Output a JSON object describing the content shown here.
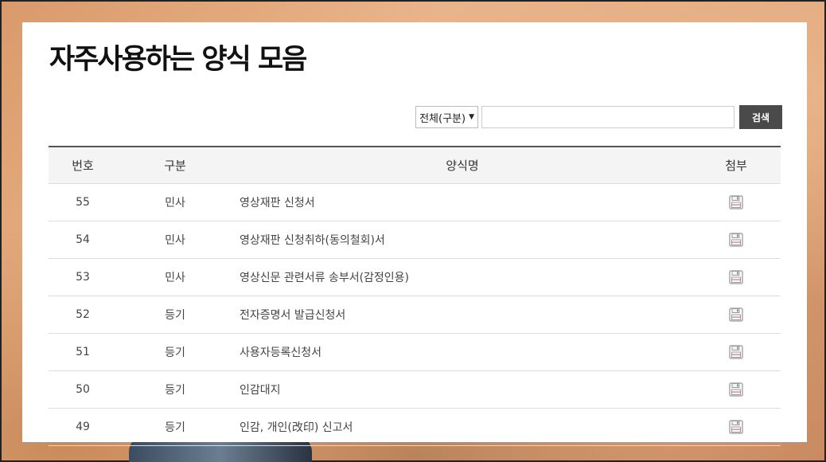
{
  "page": {
    "title": "자주사용하는 양식 모음"
  },
  "search": {
    "category_selected": "전체(구분)",
    "query_value": "",
    "query_placeholder": "",
    "button_label": "검색"
  },
  "table": {
    "headers": {
      "no": "번호",
      "category": "구분",
      "name": "양식명",
      "attachment": "첨부"
    },
    "rows": [
      {
        "no": "55",
        "category": "민사",
        "name": "영상재판 신청서",
        "icon": "save-icon"
      },
      {
        "no": "54",
        "category": "민사",
        "name": "영상재판 신청취하(동의철회)서",
        "icon": "save-icon"
      },
      {
        "no": "53",
        "category": "민사",
        "name": "영상신문 관련서류 송부서(감정인용)",
        "icon": "save-icon"
      },
      {
        "no": "52",
        "category": "등기",
        "name": "전자증명서 발급신청서",
        "icon": "save-icon"
      },
      {
        "no": "51",
        "category": "등기",
        "name": "사용자등록신청서",
        "icon": "save-icon"
      },
      {
        "no": "50",
        "category": "등기",
        "name": "인감대지",
        "icon": "save-icon"
      },
      {
        "no": "49",
        "category": "등기",
        "name": "인감, 개인(改印) 신고서",
        "icon": "save-icon"
      }
    ]
  }
}
